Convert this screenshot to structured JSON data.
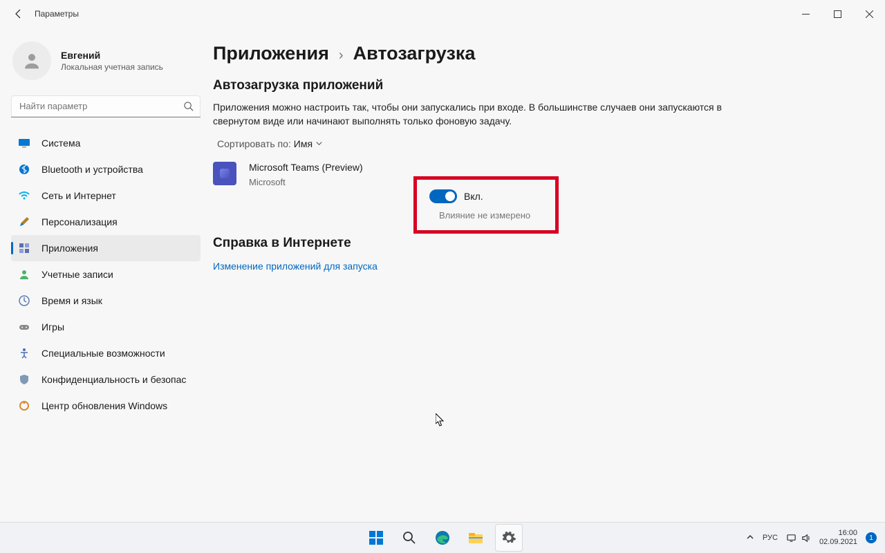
{
  "window": {
    "title": "Параметры"
  },
  "user": {
    "name": "Евгений",
    "account_type": "Локальная учетная запись"
  },
  "search": {
    "placeholder": "Найти параметр"
  },
  "sidebar": {
    "items": [
      {
        "label": "Система"
      },
      {
        "label": "Bluetooth и устройства"
      },
      {
        "label": "Сеть и Интернет"
      },
      {
        "label": "Персонализация"
      },
      {
        "label": "Приложения"
      },
      {
        "label": "Учетные записи"
      },
      {
        "label": "Время и язык"
      },
      {
        "label": "Игры"
      },
      {
        "label": "Специальные возможности"
      },
      {
        "label": "Конфиденциальность и безопас"
      },
      {
        "label": "Центр обновления Windows"
      }
    ]
  },
  "breadcrumb": {
    "parent": "Приложения",
    "current": "Автозагрузка"
  },
  "section": {
    "heading": "Автозагрузка приложений",
    "description": "Приложения можно настроить так, чтобы они запускались при входе. В большинстве случаев они запускаются в свернутом виде или начинают выполнять только фоновую задачу.",
    "sort_label": "Сортировать по:",
    "sort_value": "Имя"
  },
  "apps": [
    {
      "name": "Microsoft Teams (Preview)",
      "publisher": "Microsoft",
      "toggle_label": "Вкл.",
      "impact": "Влияние не измерено"
    }
  ],
  "help": {
    "heading": "Справка в Интернете",
    "link": "Изменение приложений для запуска"
  },
  "tray": {
    "lang": "РУС",
    "time": "16:00",
    "date": "02.09.2021",
    "badge": "1"
  }
}
